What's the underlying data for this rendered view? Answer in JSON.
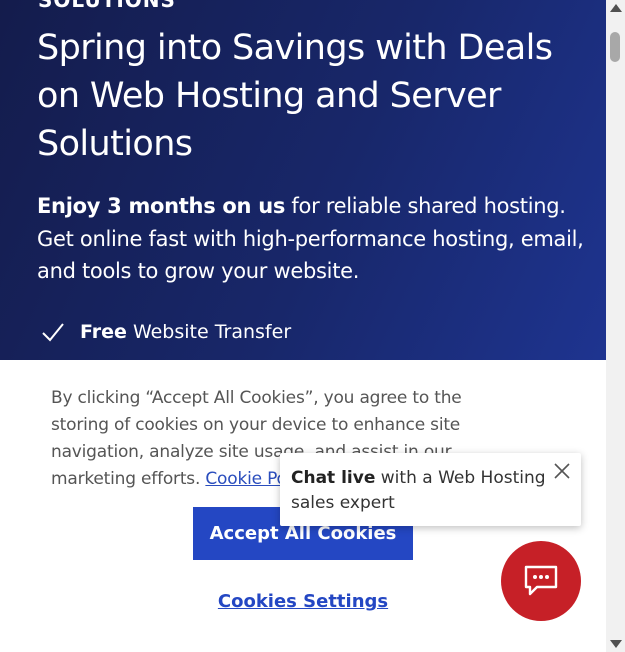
{
  "hero": {
    "eyebrow": "SOLUTIONS",
    "headline": "Spring into Savings with Deals on Web Hosting and Server Solutions",
    "desc_strong": "Enjoy 3 months on us",
    "desc_rest": " for reliable shared hosting. Get online fast with high-performance hosting, email, and tools to grow your website.",
    "feature_strong": "Free",
    "feature_rest": " Website Transfer"
  },
  "cookie": {
    "text_before": "By clicking “Accept All Cookies”, you agree to the storing of cookies on your device to enhance site navigation, analyze site usage, and assist in our marketing efforts.  ",
    "link": "Cookie Policy",
    "accept_label": "Accept All Cookies",
    "settings_label": "Cookies Settings"
  },
  "chat": {
    "strong": "Chat live",
    "rest": " with a Web Hosting sales expert"
  },
  "colors": {
    "hero_bg": "#18276a",
    "accent": "#2447c3",
    "chat_red": "#c62027"
  },
  "icons": [
    "check-icon",
    "close-icon",
    "chat-icon"
  ]
}
